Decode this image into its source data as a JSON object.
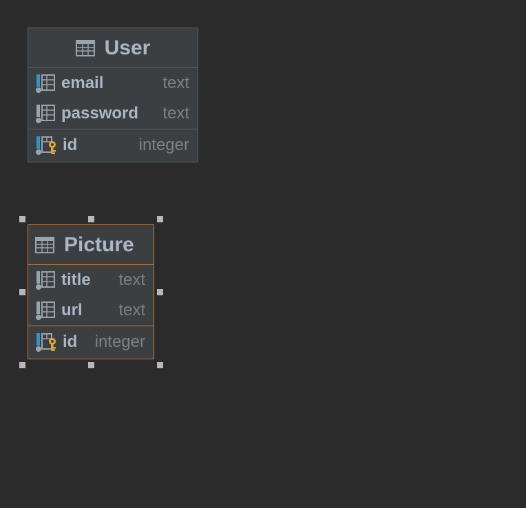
{
  "colors": {
    "background": "#2b2b2b",
    "table_bg": "#3c3f41",
    "table_border": "#5d6062",
    "selected_border": "#c77832",
    "column_name": "#a9b7c6",
    "column_type": "#808080",
    "key_icon": "#e3a830",
    "column_icon_accent": "#3592c4"
  },
  "tables": {
    "user": {
      "title": "User",
      "icon": "table-icon",
      "selected": false,
      "columns": [
        {
          "name": "email",
          "type": "text",
          "icon": "column-icon"
        },
        {
          "name": "password",
          "type": "text",
          "icon": "column-icon"
        }
      ],
      "keys": [
        {
          "name": "id",
          "type": "integer",
          "icon": "primary-key-column-icon"
        }
      ]
    },
    "picture": {
      "title": "Picture",
      "icon": "table-icon",
      "selected": true,
      "columns": [
        {
          "name": "title",
          "type": "text",
          "icon": "column-icon"
        },
        {
          "name": "url",
          "type": "text",
          "icon": "column-icon"
        }
      ],
      "keys": [
        {
          "name": "id",
          "type": "integer",
          "icon": "primary-key-column-icon"
        }
      ]
    }
  }
}
